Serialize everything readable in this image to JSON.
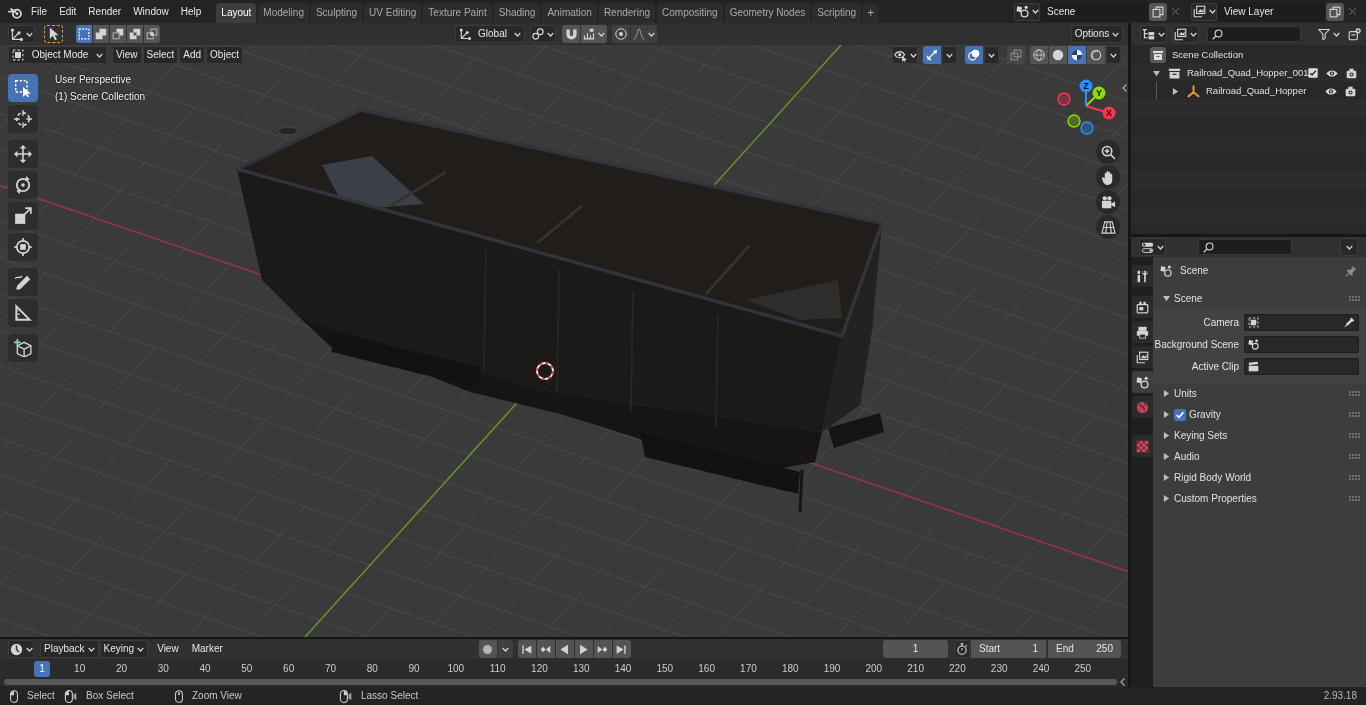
{
  "top_bar": {
    "menus": [
      "File",
      "Edit",
      "Render",
      "Window",
      "Help"
    ],
    "workspaces": [
      {
        "label": "Layout",
        "selected": true
      },
      {
        "label": "Modeling",
        "selected": false
      },
      {
        "label": "Sculpting",
        "selected": false
      },
      {
        "label": "UV Editing",
        "selected": false
      },
      {
        "label": "Texture Paint",
        "selected": false
      },
      {
        "label": "Shading",
        "selected": false
      },
      {
        "label": "Animation",
        "selected": false
      },
      {
        "label": "Rendering",
        "selected": false
      },
      {
        "label": "Compositing",
        "selected": false
      },
      {
        "label": "Geometry Nodes",
        "selected": false
      },
      {
        "label": "Scripting",
        "selected": false
      }
    ],
    "add_workspace": "+",
    "scene": "Scene",
    "view_layer": "View Layer"
  },
  "viewport": {
    "tool_settings": {
      "select_modes": [
        {
          "kind": "set",
          "selected": true
        },
        {
          "kind": "extend",
          "selected": false
        },
        {
          "kind": "subtract",
          "selected": false
        },
        {
          "kind": "difference",
          "selected": false
        },
        {
          "kind": "intersect",
          "selected": false
        }
      ],
      "orientation": "Global",
      "options": "Options"
    },
    "header": {
      "mode": "Object Mode",
      "menus": [
        "View",
        "Select",
        "Add",
        "Object"
      ],
      "toggles": [
        {
          "kind": "gizmos",
          "on": true
        },
        {
          "kind": "overlays",
          "on": true
        },
        {
          "kind": "xray",
          "on": false
        }
      ],
      "shading": [
        {
          "kind": "wireframe",
          "selected": false
        },
        {
          "kind": "solid",
          "selected": false
        },
        {
          "kind": "material",
          "selected": true
        },
        {
          "kind": "rendered",
          "selected": false
        }
      ]
    },
    "info": [
      "User Perspective",
      "(1) Scene Collection"
    ],
    "tool_groups": [
      [
        {
          "kind": "select_box",
          "selected": true
        },
        {
          "kind": "cursor",
          "selected": false
        }
      ],
      [
        {
          "kind": "move",
          "selected": false
        },
        {
          "kind": "rotate",
          "selected": false
        },
        {
          "kind": "scale",
          "selected": false
        },
        {
          "kind": "transform",
          "selected": false
        }
      ],
      [
        {
          "kind": "annotate",
          "selected": false
        },
        {
          "kind": "measure",
          "selected": false
        }
      ],
      [
        {
          "kind": "add_cube",
          "selected": false
        }
      ]
    ],
    "axes": [
      {
        "label": "X",
        "color": "#ff3352"
      },
      {
        "label": "Y",
        "color": "#8bdc00"
      },
      {
        "label": "Z",
        "color": "#2890ff"
      }
    ]
  },
  "outliner": {
    "tree": [
      {
        "label": "Scene Collection",
        "kind": "scene_collection",
        "children": [
          {
            "label": "Railroad_Quad_Hopper_001",
            "kind": "collection",
            "expanded": true,
            "checked": true,
            "children": [
              {
                "label": "Railroad_Quad_Hopper",
                "kind": "empty",
                "expanded": false
              }
            ]
          }
        ]
      }
    ]
  },
  "properties": {
    "tab_groups": [
      [
        {
          "kind": "tool",
          "selected": false
        }
      ],
      [
        {
          "kind": "render",
          "selected": false
        },
        {
          "kind": "output",
          "selected": false
        },
        {
          "kind": "view_layer",
          "selected": false
        },
        {
          "kind": "scene",
          "selected": true
        },
        {
          "kind": "world",
          "selected": false
        }
      ],
      [
        {
          "kind": "texture",
          "selected": false
        }
      ]
    ],
    "title": "Scene",
    "panels": [
      {
        "label": "Scene",
        "expanded": true,
        "fields": [
          {
            "label": "Camera",
            "kind": "camera"
          },
          {
            "label": "Background Scene",
            "kind": "scene"
          },
          {
            "label": "Active Clip",
            "kind": "clip"
          }
        ]
      },
      {
        "label": "Units",
        "expanded": false
      },
      {
        "label": "Gravity",
        "expanded": false,
        "checked": true
      },
      {
        "label": "Keying Sets",
        "expanded": false
      },
      {
        "label": "Audio",
        "expanded": false
      },
      {
        "label": "Rigid Body World",
        "expanded": false
      },
      {
        "label": "Custom Properties",
        "expanded": false
      }
    ]
  },
  "timeline": {
    "menus": [
      {
        "label": "Playback",
        "kind": "dropdown"
      },
      {
        "label": "Keying",
        "kind": "dropdown"
      },
      {
        "label": "View",
        "kind": "menu"
      },
      {
        "label": "Marker",
        "kind": "menu"
      }
    ],
    "auto_keying": false,
    "current_frame": "1",
    "start": {
      "label": "Start",
      "value": "1"
    },
    "end": {
      "label": "End",
      "value": "250"
    },
    "frames": [
      {
        "label": "1",
        "selected": true
      },
      {
        "label": "10",
        "selected": false
      },
      {
        "label": "20",
        "selected": false
      },
      {
        "label": "30",
        "selected": false
      },
      {
        "label": "40",
        "selected": false
      },
      {
        "label": "50",
        "selected": false
      },
      {
        "label": "60",
        "selected": false
      },
      {
        "label": "70",
        "selected": false
      },
      {
        "label": "80",
        "selected": false
      },
      {
        "label": "90",
        "selected": false
      },
      {
        "label": "100",
        "selected": false
      },
      {
        "label": "110",
        "selected": false
      },
      {
        "label": "120",
        "selected": false
      },
      {
        "label": "130",
        "selected": false
      },
      {
        "label": "140",
        "selected": false
      },
      {
        "label": "150",
        "selected": false
      },
      {
        "label": "160",
        "selected": false
      },
      {
        "label": "170",
        "selected": false
      },
      {
        "label": "180",
        "selected": false
      },
      {
        "label": "190",
        "selected": false
      },
      {
        "label": "200",
        "selected": false
      },
      {
        "label": "210",
        "selected": false
      },
      {
        "label": "220",
        "selected": false
      },
      {
        "label": "230",
        "selected": false
      },
      {
        "label": "240",
        "selected": false
      },
      {
        "label": "250",
        "selected": false
      }
    ]
  },
  "status_bar": {
    "hints": [
      {
        "kind": "click",
        "label": "Select"
      },
      {
        "kind": "drag",
        "label": "Box Select"
      },
      {
        "kind": "middle",
        "label": "Zoom View"
      },
      {
        "kind": "right_drag",
        "label": "Lasso Select"
      }
    ],
    "version": "2.93.18"
  }
}
